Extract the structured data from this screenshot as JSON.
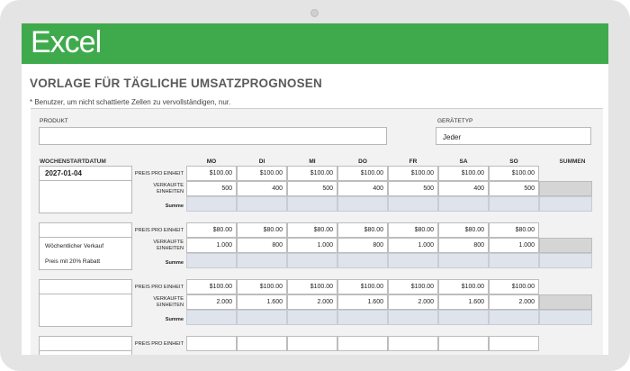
{
  "app": {
    "name": "Excel"
  },
  "header": {
    "title": "VORLAGE FÜR TÄGLICHE UMSATZPROGNOSEN",
    "note": "* Benutzer, um nicht schattierte Zellen zu vervollständigen, nur."
  },
  "form": {
    "product_label": "PRODUKT",
    "product_value": "",
    "device_type_label": "GERÄTETYP",
    "device_type_value": "Jeder",
    "week_start_label": "WOCHENSTARTDATUM",
    "sums_label": "SUMMEN"
  },
  "days": [
    "MO",
    "DI",
    "MI",
    "DO",
    "FR",
    "SA",
    "SO"
  ],
  "row_labels": {
    "price": "PREIS PRO EINHEIT",
    "sold_1": "VERKAUFTE",
    "sold_2": "EINHEITEN",
    "sum": "Summe"
  },
  "blocks": [
    {
      "date": "2027-01-04",
      "notes": [],
      "prices": [
        "$100.00",
        "$100.00",
        "$100.00",
        "$100.00",
        "$100.00",
        "$100.00",
        "$100.00"
      ],
      "units": [
        "500",
        "400",
        "500",
        "400",
        "500",
        "400",
        "500"
      ]
    },
    {
      "date": "",
      "notes": [
        "Wöchentlicher Verkauf",
        "Preis mit 20% Rabatt"
      ],
      "prices": [
        "$80.00",
        "$80.00",
        "$80.00",
        "$80.00",
        "$80.00",
        "$80.00",
        "$80.00"
      ],
      "units": [
        "1.000",
        "800",
        "1.000",
        "800",
        "1.000",
        "800",
        "1.000"
      ]
    },
    {
      "date": "",
      "notes": [],
      "prices": [
        "$100.00",
        "$100.00",
        "$100.00",
        "$100.00",
        "$100.00",
        "$100.00",
        "$100.00"
      ],
      "units": [
        "2.000",
        "1.600",
        "2.000",
        "1.600",
        "2.000",
        "1.600",
        "2.000"
      ]
    },
    {
      "date": "",
      "notes": [],
      "prices": [
        "",
        "",
        "",
        "",
        "",
        "",
        ""
      ],
      "units": []
    }
  ]
}
